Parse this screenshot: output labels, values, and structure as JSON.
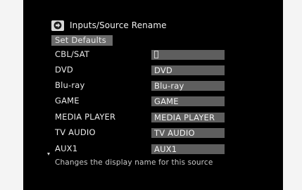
{
  "header": {
    "icon": "input-arrow-icon",
    "title": "Inputs/Source Rename"
  },
  "set_defaults_label": "Set Defaults",
  "sources": [
    {
      "label": "CBL/SAT",
      "value": ""
    },
    {
      "label": "DVD",
      "value": "DVD"
    },
    {
      "label": "Blu-ray",
      "value": "Blu-ray"
    },
    {
      "label": "GAME",
      "value": "GAME"
    },
    {
      "label": "MEDIA PLAYER",
      "value": "MEDIA PLAYER"
    },
    {
      "label": "TV AUDIO",
      "value": "TV AUDIO"
    },
    {
      "label": "AUX1",
      "value": "AUX1"
    }
  ],
  "help_text": "Changes the display name for this source",
  "colors": {
    "screen_bg": "#000000",
    "field_bg": "#5e5e5e",
    "button_bg": "#6b6b6b",
    "text": "#eaeaea"
  }
}
